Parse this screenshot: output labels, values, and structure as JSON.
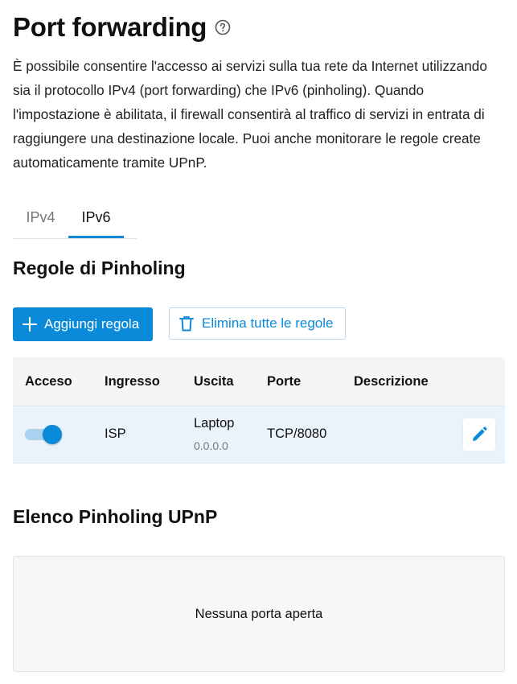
{
  "header": {
    "title": "Port forwarding",
    "help_icon": "help-circle-icon",
    "description": "È possibile consentire l'accesso ai servizi sulla tua rete da Internet utilizzando sia il protocollo IPv4 (port forwarding) che IPv6 (pinholing). Quando l'impostazione è abilitata, il firewall consentirà al traffico di servizi in entrata di raggiungere una destinazione locale. Puoi anche monitorare le regole create automaticamente tramite UPnP."
  },
  "tabs": [
    {
      "label": "IPv4",
      "selected": false
    },
    {
      "label": "IPv6",
      "selected": true
    }
  ],
  "rules_section": {
    "title": "Regole di Pinholing",
    "add_button": {
      "label": "Aggiungi regola",
      "icon": "plus-icon"
    },
    "delete_all_button": {
      "label": "Elimina tutte le regole",
      "icon": "trash-icon"
    },
    "columns": [
      "Acceso",
      "Ingresso",
      "Uscita",
      "Porte",
      "Descrizione"
    ],
    "rows": [
      {
        "enabled": true,
        "ingress": "ISP",
        "egress_name": "Laptop",
        "egress_address": "0.0.0.0",
        "ports": "TCP/8080",
        "description": "",
        "edit_icon": "pencil-icon"
      }
    ]
  },
  "upnp_section": {
    "title": "Elenco Pinholing UPnP",
    "empty_message": "Nessuna porta aperta"
  },
  "colors": {
    "accent": "#0a8ad8",
    "row_highlight": "#eaf3fa",
    "header_bg": "#f5f5f5"
  }
}
